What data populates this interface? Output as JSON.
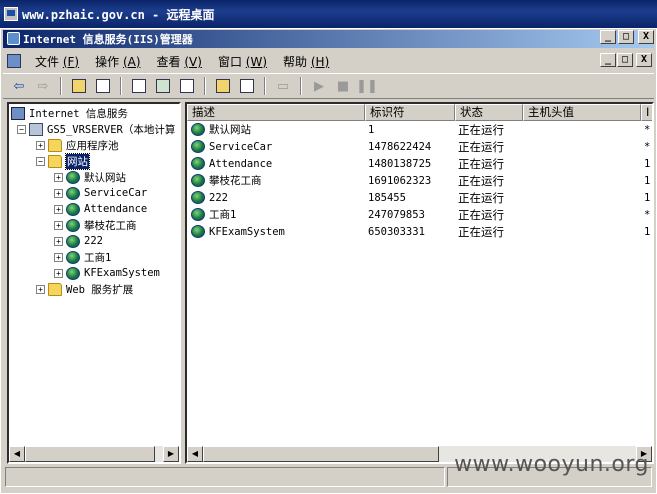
{
  "remote_desktop": {
    "title": "www.pzhaic.gov.cn - 远程桌面"
  },
  "window": {
    "title": "Internet 信息服务(IIS)管理器",
    "controls": {
      "minimize": "_",
      "maximize": "□",
      "close": "X"
    }
  },
  "menu": [
    {
      "label": "文件",
      "accel": "(F)"
    },
    {
      "label": "操作",
      "accel": "(A)"
    },
    {
      "label": "查看",
      "accel": "(V)"
    },
    {
      "label": "窗口",
      "accel": "(W)"
    },
    {
      "label": "帮助",
      "accel": "(H)"
    }
  ],
  "tree": {
    "root": "Internet 信息服务",
    "server": "GS5_VRSERVER（本地计算",
    "app_pools": "应用程序池",
    "websites": "网站",
    "sites": [
      "默认网站",
      "ServiceCar",
      "Attendance",
      "攀枝花工商",
      "222",
      "工商1",
      "KFExamSystem"
    ],
    "web_ext": "Web 服务扩展"
  },
  "list": {
    "columns": [
      "描述",
      "标识符",
      "状态",
      "主机头值",
      "I"
    ],
    "rows": [
      {
        "desc": "默认网站",
        "id": "1",
        "status": "正在运行",
        "host": "",
        "ip": "*"
      },
      {
        "desc": "ServiceCar",
        "id": "1478622424",
        "status": "正在运行",
        "host": "",
        "ip": "*"
      },
      {
        "desc": "Attendance",
        "id": "1480138725",
        "status": "正在运行",
        "host": "",
        "ip": "1"
      },
      {
        "desc": "攀枝花工商",
        "id": "1691062323",
        "status": "正在运行",
        "host": "",
        "ip": "1"
      },
      {
        "desc": "222",
        "id": "185455",
        "status": "正在运行",
        "host": "",
        "ip": "1"
      },
      {
        "desc": "工商1",
        "id": "247079853",
        "status": "正在运行",
        "host": "",
        "ip": "*"
      },
      {
        "desc": "KFExamSystem",
        "id": "650303331",
        "status": "正在运行",
        "host": "",
        "ip": "1"
      }
    ]
  },
  "watermark": "www.wooyun.org"
}
